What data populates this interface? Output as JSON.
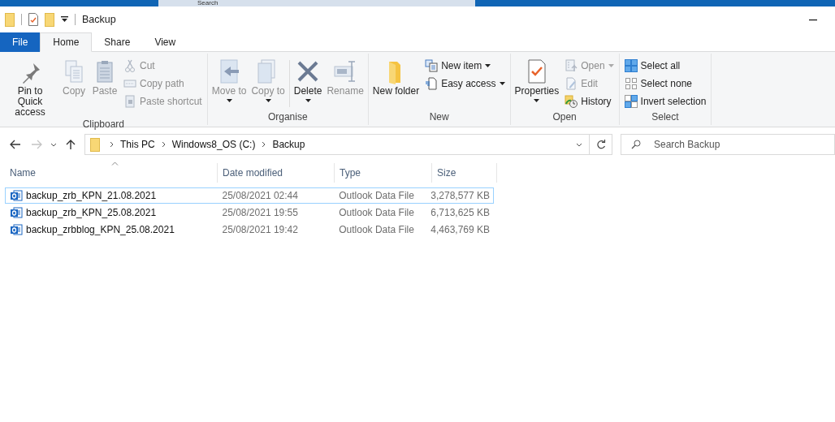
{
  "taskbar": {
    "search_label": "Search"
  },
  "window": {
    "title": "Backup"
  },
  "tabs": [
    {
      "label": "File",
      "kind": "file",
      "selected": false
    },
    {
      "label": "Home",
      "kind": "tab",
      "selected": true
    },
    {
      "label": "Share",
      "kind": "tab",
      "selected": false
    },
    {
      "label": "View",
      "kind": "tab",
      "selected": false
    }
  ],
  "ribbon": {
    "groups": [
      {
        "label": "Clipboard",
        "items": [
          {
            "label": "Pin to Quick access",
            "kind": "large",
            "disabled": false,
            "dropdown": false
          },
          {
            "label": "Copy",
            "kind": "large",
            "disabled": true,
            "dropdown": false
          },
          {
            "label": "Paste",
            "kind": "large",
            "disabled": true,
            "dropdown": false
          },
          {
            "kind": "stack",
            "items": [
              {
                "label": "Cut",
                "disabled": true,
                "dropdown": false
              },
              {
                "label": "Copy path",
                "disabled": true,
                "dropdown": false
              },
              {
                "label": "Paste shortcut",
                "disabled": true,
                "dropdown": false
              }
            ]
          }
        ]
      },
      {
        "label": "Organise",
        "items": [
          {
            "label": "Move to",
            "kind": "large",
            "disabled": true,
            "dropdown": true
          },
          {
            "label": "Copy to",
            "kind": "large",
            "disabled": true,
            "dropdown": true
          },
          {
            "kind": "separator"
          },
          {
            "label": "Delete",
            "kind": "large",
            "disabled": false,
            "dropdown": true
          },
          {
            "label": "Rename",
            "kind": "large",
            "disabled": true,
            "dropdown": false
          }
        ]
      },
      {
        "label": "New",
        "items": [
          {
            "label": "New folder",
            "kind": "large",
            "disabled": false,
            "dropdown": false
          },
          {
            "kind": "stack",
            "items": [
              {
                "label": "New item",
                "disabled": false,
                "dropdown": true
              },
              {
                "label": "Easy access",
                "disabled": false,
                "dropdown": true
              }
            ]
          }
        ]
      },
      {
        "label": "Open",
        "items": [
          {
            "label": "Properties",
            "kind": "large",
            "disabled": false,
            "dropdown": true
          },
          {
            "kind": "stack",
            "items": [
              {
                "label": "Open",
                "disabled": true,
                "dropdown": true
              },
              {
                "label": "Edit",
                "disabled": true,
                "dropdown": false
              },
              {
                "label": "History",
                "disabled": false,
                "dropdown": false
              }
            ]
          }
        ]
      },
      {
        "label": "Select",
        "items": [
          {
            "kind": "stack",
            "items": [
              {
                "label": "Select all",
                "disabled": false,
                "dropdown": false
              },
              {
                "label": "Select none",
                "disabled": false,
                "dropdown": false
              },
              {
                "label": "Invert selection",
                "disabled": false,
                "dropdown": false
              }
            ]
          }
        ]
      }
    ]
  },
  "address": {
    "breadcrumbs": [
      "This PC",
      "Windows8_OS (C:)",
      "Backup"
    ],
    "back_disabled": false,
    "forward_disabled": true
  },
  "search": {
    "placeholder": "Search Backup"
  },
  "table": {
    "columns": [
      {
        "label": "Name",
        "sorted": true
      },
      {
        "label": "Date modified",
        "sorted": false
      },
      {
        "label": "Type",
        "sorted": false
      },
      {
        "label": "Size",
        "sorted": false
      }
    ],
    "rows": [
      {
        "cells": [
          "backup_zrb_KPN_21.08.2021",
          "25/08/2021 02:44",
          "Outlook Data File",
          "3,278,577 KB"
        ],
        "focused": true
      },
      {
        "cells": [
          "backup_zrb_KPN_25.08.2021",
          "25/08/2021 19:55",
          "Outlook Data File",
          "6,713,625 KB"
        ],
        "focused": false
      },
      {
        "cells": [
          "backup_zrbblog_KPN_25.08.2021",
          "25/08/2021 19:42",
          "Outlook Data File",
          "4,463,769 KB"
        ],
        "focused": false
      }
    ]
  }
}
